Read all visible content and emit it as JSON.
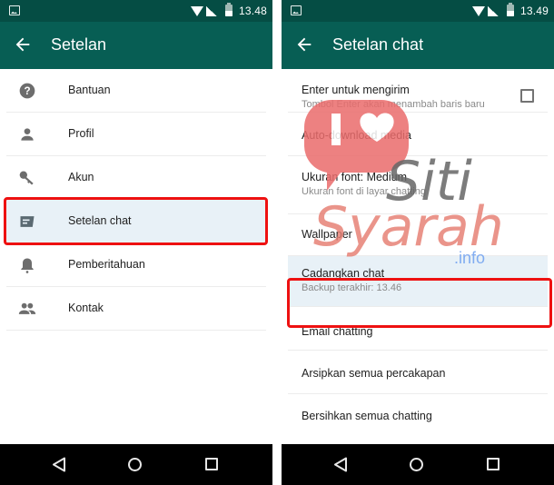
{
  "left_screen": {
    "status_bar": {
      "time": "13.48",
      "icons": [
        "image-notification-icon",
        "wifi-icon",
        "signal-icon",
        "battery-icon"
      ]
    },
    "toolbar": {
      "title": "Setelan",
      "back_icon": "arrow-left-icon"
    },
    "menu": [
      {
        "label": "Bantuan",
        "icon": "help-circle-icon"
      },
      {
        "label": "Profil",
        "icon": "person-icon"
      },
      {
        "label": "Akun",
        "icon": "key-icon"
      },
      {
        "label": "Setelan chat",
        "icon": "chat-icon",
        "highlighted": true
      },
      {
        "label": "Pemberitahuan",
        "icon": "bell-icon"
      },
      {
        "label": "Kontak",
        "icon": "contacts-icon"
      }
    ],
    "nav_bar": [
      "back",
      "home",
      "recents"
    ]
  },
  "right_screen": {
    "status_bar": {
      "time": "13.49"
    },
    "toolbar": {
      "title": "Setelan chat",
      "back_icon": "arrow-left-icon"
    },
    "settings": [
      {
        "primary": "Enter untuk mengirim",
        "secondary": "Tombol Enter akan menambah baris baru",
        "checkbox": false
      },
      {
        "primary": "Auto-download media",
        "secondary": ""
      },
      {
        "primary": "Ukuran font: Medium",
        "secondary": "Ukuran font di layar chatting"
      },
      {
        "primary": "Wallpaper",
        "secondary": ""
      },
      {
        "primary": "Cadangkan chat",
        "secondary": "Backup terakhir: 13.46",
        "highlighted": true
      },
      {
        "primary": "Email chatting",
        "secondary": ""
      },
      {
        "primary": "Arsipkan semua percakapan",
        "secondary": ""
      },
      {
        "primary": "Bersihkan semua chatting",
        "secondary": ""
      }
    ]
  },
  "watermark": {
    "line1": "Siti",
    "line2": "Syarah",
    "suffix": ".info",
    "badge": "I ♥"
  },
  "colors": {
    "status_bar": "#054d44",
    "toolbar": "#075e54",
    "highlight_bg": "#e8f1f7",
    "annotation_red": "#ee1111",
    "icon_gray": "#6d6d6d"
  }
}
